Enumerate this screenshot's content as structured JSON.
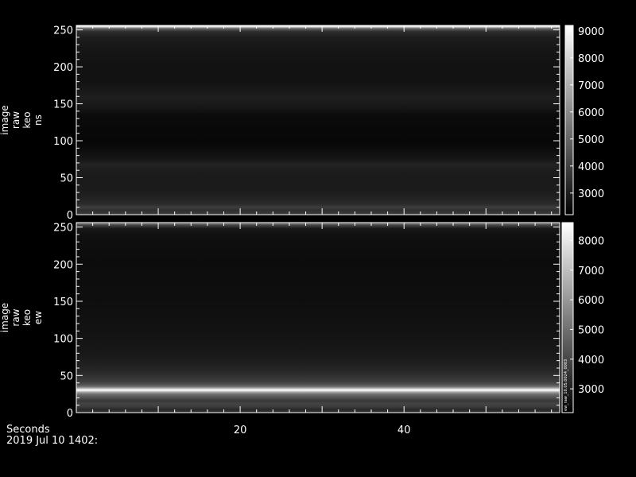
{
  "chart_data": [
    {
      "type": "heatmap",
      "panel_label": [
        "image",
        "raw",
        "keo",
        "ns"
      ],
      "ylim": [
        0,
        256
      ],
      "yticks": [
        0,
        50,
        100,
        150,
        200,
        250
      ],
      "xlim": [
        0,
        59
      ],
      "xticks": [
        20,
        40
      ],
      "colorbar": {
        "range": [
          2200,
          9200
        ],
        "ticks": [
          3000,
          4000,
          5000,
          6000,
          7000,
          8000,
          9000
        ]
      },
      "row_profile": [
        [
          0,
          3900
        ],
        [
          3,
          3700
        ],
        [
          6,
          3500
        ],
        [
          10,
          3900
        ],
        [
          14,
          3400
        ],
        [
          20,
          3200
        ],
        [
          30,
          3000
        ],
        [
          45,
          2900
        ],
        [
          60,
          3000
        ],
        [
          68,
          3150
        ],
        [
          75,
          2800
        ],
        [
          90,
          2500
        ],
        [
          100,
          2400
        ],
        [
          120,
          2450
        ],
        [
          135,
          2500
        ],
        [
          140,
          2700
        ],
        [
          150,
          2900
        ],
        [
          158,
          3050
        ],
        [
          165,
          2900
        ],
        [
          180,
          2700
        ],
        [
          200,
          2700
        ],
        [
          215,
          2750
        ],
        [
          230,
          2850
        ],
        [
          240,
          3000
        ],
        [
          248,
          3500
        ],
        [
          252,
          5200
        ],
        [
          254,
          8200
        ],
        [
          255,
          9000
        ],
        [
          256,
          9000
        ]
      ]
    },
    {
      "type": "heatmap",
      "panel_label": [
        "image",
        "raw",
        "keo",
        "ew"
      ],
      "ylim": [
        0,
        256
      ],
      "yticks": [
        0,
        50,
        100,
        150,
        200,
        250
      ],
      "xlim": [
        0,
        59
      ],
      "xticks": [
        20,
        40
      ],
      "colorbar": {
        "range": [
          2200,
          8600
        ],
        "ticks": [
          3000,
          4000,
          5000,
          6000,
          7000,
          8000
        ]
      },
      "colorbar_note": "ew_raw_10.05.0024_0003",
      "row_profile": [
        [
          0,
          3500
        ],
        [
          4,
          3200
        ],
        [
          8,
          3700
        ],
        [
          12,
          3900
        ],
        [
          16,
          3600
        ],
        [
          20,
          4200
        ],
        [
          24,
          4800
        ],
        [
          27,
          6000
        ],
        [
          29,
          7600
        ],
        [
          30,
          8500
        ],
        [
          31,
          8300
        ],
        [
          33,
          6500
        ],
        [
          35,
          5000
        ],
        [
          38,
          4200
        ],
        [
          42,
          3700
        ],
        [
          48,
          3500
        ],
        [
          55,
          3200
        ],
        [
          65,
          3000
        ],
        [
          80,
          2800
        ],
        [
          90,
          2750
        ],
        [
          100,
          2700
        ],
        [
          130,
          2600
        ],
        [
          160,
          2550
        ],
        [
          200,
          2500
        ],
        [
          230,
          2550
        ],
        [
          240,
          2600
        ],
        [
          248,
          2800
        ],
        [
          252,
          3800
        ],
        [
          255,
          5000
        ],
        [
          256,
          5000
        ]
      ]
    }
  ],
  "footer": {
    "xaxis_label": "Seconds",
    "timestamp": "2019 Jul 10 1402:"
  }
}
